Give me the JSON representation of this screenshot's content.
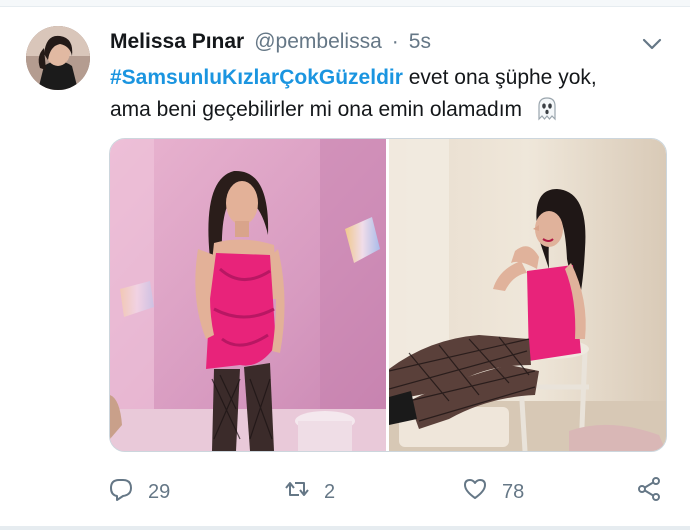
{
  "tweet": {
    "author_name": "Melissa Pınar",
    "author_handle": "@pembelissa",
    "separator": "·",
    "timestamp": "5s",
    "hashtag": "#SamsunluKızlarÇokGüzeldir",
    "text_line1_rest": " evet ona şüphe yok,",
    "text_line2": "ama beni geçebilirler mi ona emin olamadım",
    "emoji_icon": "ghost-icon",
    "hashtag_color": "#1b95e0",
    "secondary_color": "#657786"
  },
  "media": {
    "images": [
      {
        "name": "photo-left",
        "description_icon": "photo"
      },
      {
        "name": "photo-right",
        "description_icon": "photo"
      }
    ]
  },
  "actions": {
    "reply_count": "29",
    "retweet_count": "2",
    "like_count": "78",
    "icons": [
      "reply-icon",
      "retweet-icon",
      "like-icon",
      "share-icon"
    ]
  }
}
